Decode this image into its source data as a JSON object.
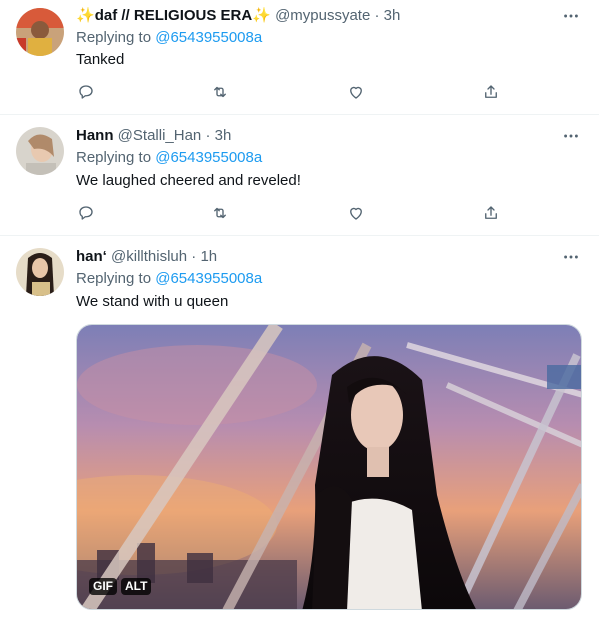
{
  "tweets": [
    {
      "name_prefix": "✨",
      "name": "daf // RELIGIOUS ERA",
      "name_suffix": "✨",
      "handle": "@mypussyate",
      "dot": "·",
      "time": "3h",
      "replying_label": "Replying to",
      "replying_to": "@6543955008a",
      "text": "Tanked"
    },
    {
      "name": "Hann",
      "handle": "@Stalli_Han",
      "dot": "·",
      "time": "3h",
      "replying_label": "Replying to",
      "replying_to": "@6543955008a",
      "text": "We laughed cheered and reveled!"
    },
    {
      "name": "han‘",
      "handle": "@killthisluh",
      "dot": "·",
      "time": "1h",
      "replying_label": "Replying to",
      "replying_to": "@6543955008a",
      "text": "We stand with u queen",
      "media": {
        "gif_badge": "GIF",
        "alt_badge": "ALT"
      }
    }
  ],
  "icons": [
    "more-icon",
    "reply-icon",
    "retweet-icon",
    "like-icon",
    "share-icon"
  ],
  "colors": {
    "accent": "#1d9bf0",
    "secondary_text": "#536471",
    "primary_text": "#0f1419"
  }
}
